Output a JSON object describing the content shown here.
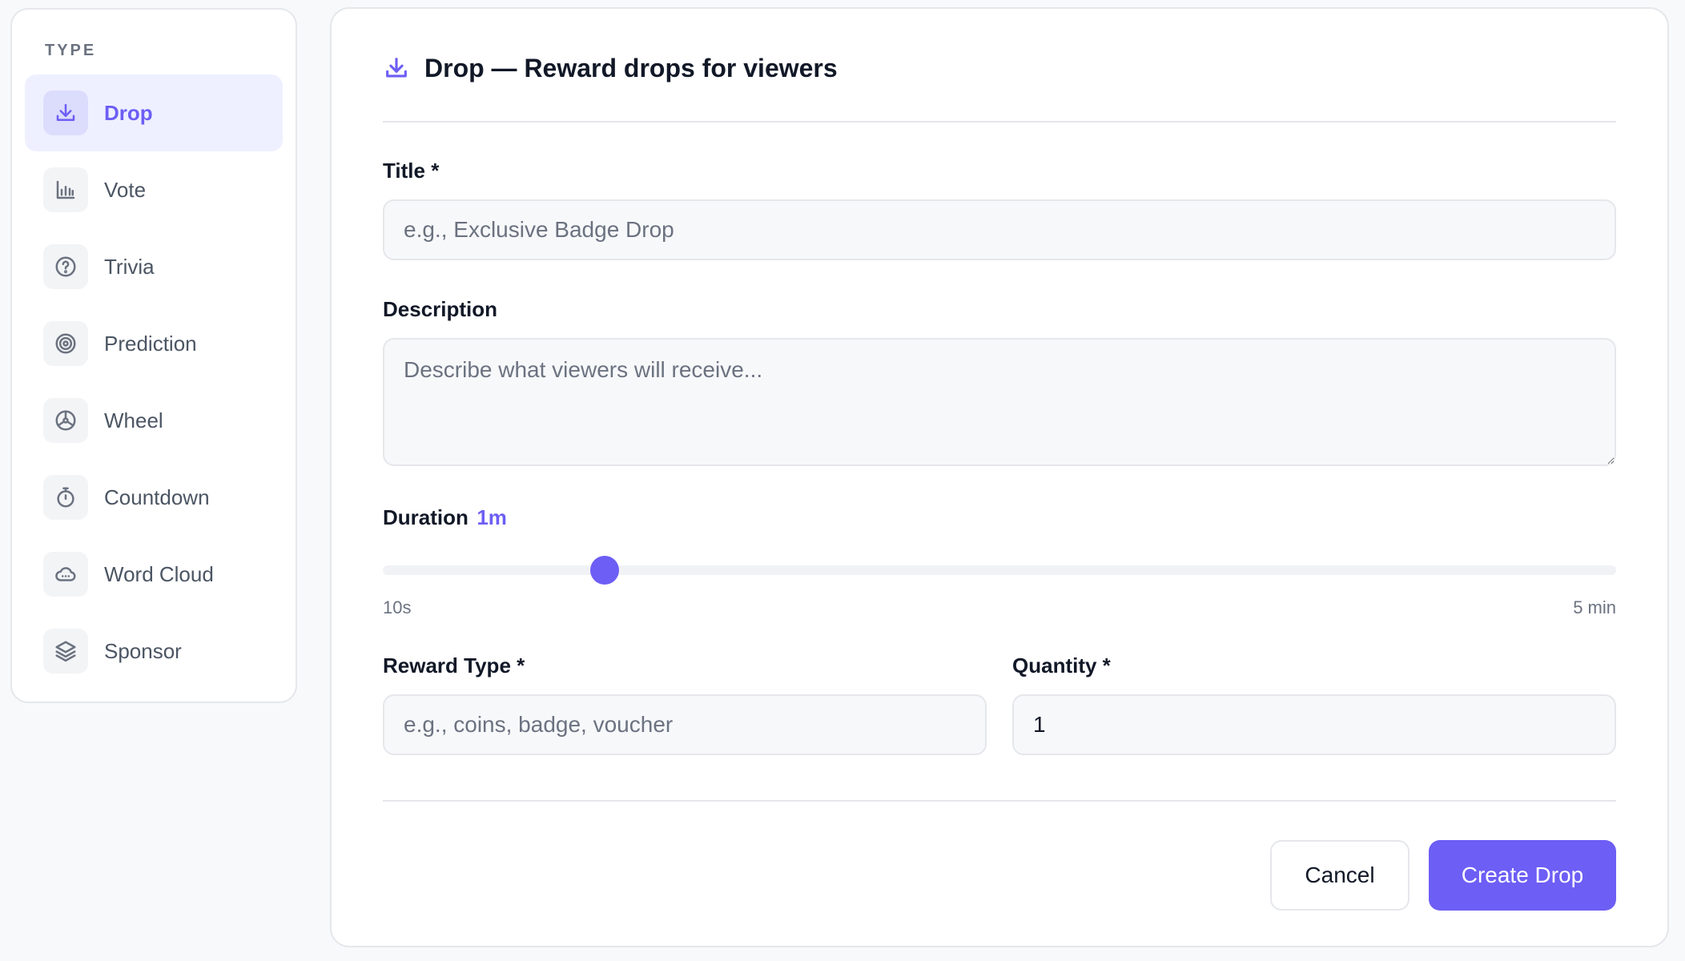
{
  "sidebar": {
    "heading": "TYPE",
    "items": [
      {
        "label": "Drop",
        "icon": "download-icon",
        "active": true
      },
      {
        "label": "Vote",
        "icon": "bar-chart-icon",
        "active": false
      },
      {
        "label": "Trivia",
        "icon": "question-circle-icon",
        "active": false
      },
      {
        "label": "Prediction",
        "icon": "target-icon",
        "active": false
      },
      {
        "label": "Wheel",
        "icon": "wheel-icon",
        "active": false
      },
      {
        "label": "Countdown",
        "icon": "timer-icon",
        "active": false
      },
      {
        "label": "Word Cloud",
        "icon": "cloud-icon",
        "active": false
      },
      {
        "label": "Sponsor",
        "icon": "layers-icon",
        "active": false
      }
    ]
  },
  "form": {
    "header_title": "Drop — Reward drops for viewers",
    "title_label": "Title *",
    "title_placeholder": "e.g., Exclusive Badge Drop",
    "description_label": "Description",
    "description_placeholder": "Describe what viewers will receive...",
    "duration_label": "Duration",
    "duration_value": "1m",
    "duration_min_label": "10s",
    "duration_max_label": "5 min",
    "duration_fraction": 0.18,
    "reward_type_label": "Reward Type *",
    "reward_type_placeholder": "e.g., coins, badge, voucher",
    "quantity_label": "Quantity *",
    "quantity_value": "1",
    "cancel_label": "Cancel",
    "submit_label": "Create Drop"
  },
  "colors": {
    "accent": "#6d5ef5",
    "accent_soft": "#eef0ff",
    "border": "#e5e7eb"
  }
}
